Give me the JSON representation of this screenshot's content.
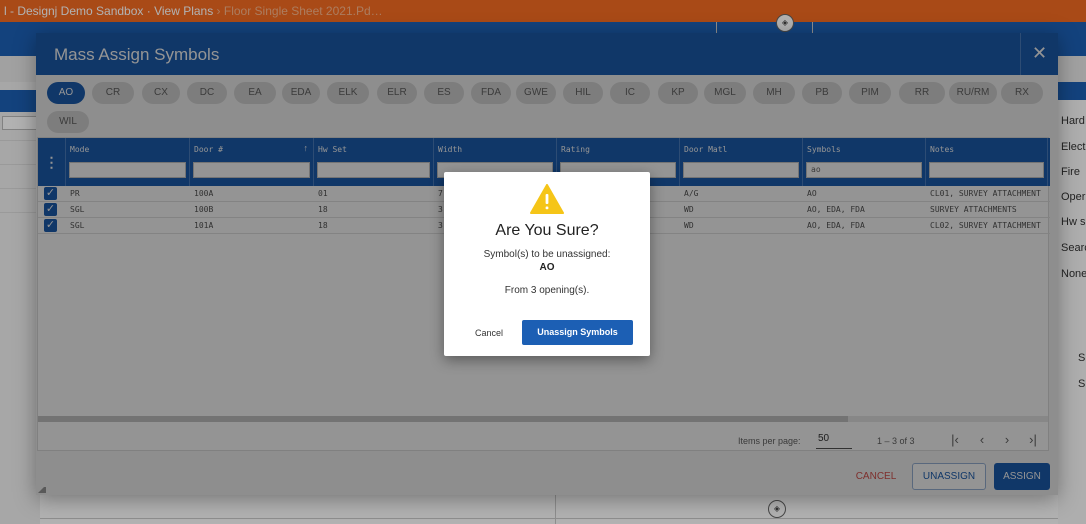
{
  "app": {
    "breadcrumb_main": "l - Designj Demo Sandbox  ·  View Plans  ",
    "breadcrumb_dim": "›  Floor Single Sheet 2021.Pd…",
    "right_panel_items": [
      "Hard",
      "Elect",
      "Fire",
      "Oper",
      "Hw s",
      "Searc",
      "None",
      "S",
      "S"
    ]
  },
  "dialog": {
    "title": "Mass Assign Symbols",
    "close_icon": "close-icon",
    "symbols": [
      "AO",
      "CR",
      "CX",
      "DC",
      "EA",
      "EDA",
      "ELK",
      "ELR",
      "ES",
      "FDA",
      "GWE",
      "HIL",
      "IC",
      "KP",
      "MGL",
      "MH",
      "PB",
      "PIM",
      "RR",
      "RU/RM",
      "RX",
      "WIL"
    ],
    "active_symbol": "AO",
    "grid": {
      "menu_icon": "⋮",
      "columns": [
        {
          "key": "mode",
          "label": "Mode",
          "filter": ""
        },
        {
          "key": "door",
          "label": "Door #",
          "filter": "",
          "sort": "↑"
        },
        {
          "key": "hwset",
          "label": "Hw Set",
          "filter": ""
        },
        {
          "key": "width",
          "label": "Width",
          "filter": ""
        },
        {
          "key": "rating",
          "label": "Rating",
          "filter": ""
        },
        {
          "key": "matl",
          "label": "Door Matl",
          "filter": ""
        },
        {
          "key": "symbols",
          "label": "Symbols",
          "filter": "ao"
        },
        {
          "key": "notes",
          "label": "Notes",
          "filter": ""
        }
      ],
      "rows": [
        {
          "mode": "PR",
          "door": "100A",
          "hwset": "01",
          "width": "7",
          "rating": "",
          "matl": "A/G",
          "symbols": "AO",
          "notes": "CL01, SURVEY ATTACHMENT"
        },
        {
          "mode": "SGL",
          "door": "100B",
          "hwset": "18",
          "width": "3",
          "rating": "",
          "matl": "WD",
          "symbols": "AO, EDA, FDA",
          "notes": "SURVEY ATTACHMENTS"
        },
        {
          "mode": "SGL",
          "door": "101A",
          "hwset": "18",
          "width": "3",
          "rating": "",
          "matl": "WD",
          "symbols": "AO, EDA, FDA",
          "notes": "CL02, SURVEY ATTACHMENT"
        }
      ]
    },
    "paginator": {
      "items_per_page_label": "Items per page:",
      "items_per_page": "50",
      "range": "1 – 3 of 3",
      "first": "|‹",
      "prev": "‹",
      "next": "›",
      "last": "›|"
    },
    "buttons": {
      "cancel": "CANCEL",
      "unassign": "UNASSIGN",
      "assign": "ASSIGN"
    }
  },
  "confirm": {
    "icon": "warning-icon",
    "title": "Are You Sure?",
    "message": "Symbol(s) to be unassigned:",
    "symbols": "AO",
    "from": "From 3 opening(s).",
    "cancel": "Cancel",
    "confirm": "Unassign Symbols"
  },
  "colors": {
    "brand_blue": "#1c5fb4",
    "orange": "#f26a21",
    "warning": "#f5c518",
    "cancel_red": "#d9534f"
  }
}
